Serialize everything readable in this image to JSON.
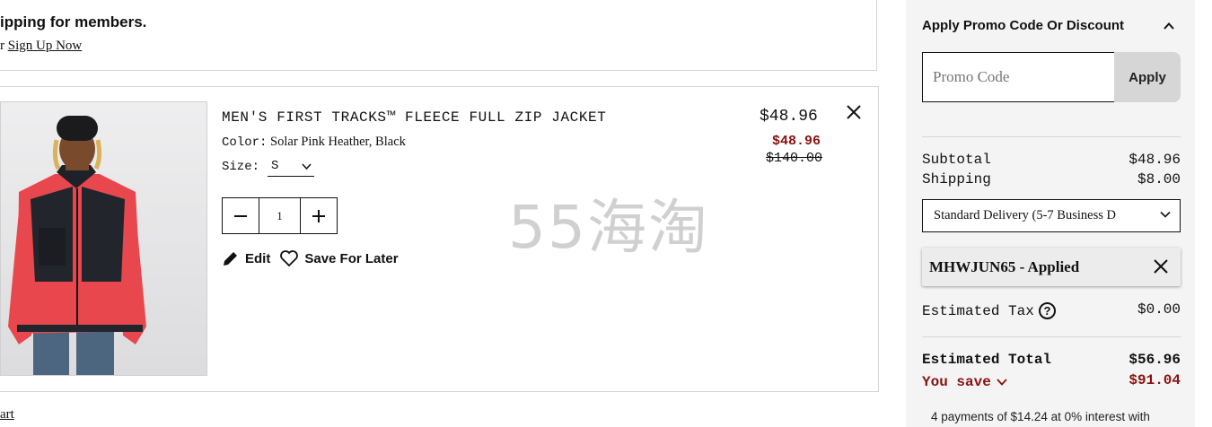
{
  "banner": {
    "title": "ipping for members.",
    "sub_prefix": "r",
    "sign_up_link": "Sign Up Now"
  },
  "product": {
    "name": "MEN'S FIRST TRACKS™ FLEECE FULL ZIP JACKET",
    "color_label": "Color:",
    "color_value": "Solar Pink Heather, Black",
    "size_label": "Size:",
    "size_value": "S",
    "quantity": "1",
    "edit_label": "Edit",
    "save_later_label": "Save For Later",
    "price": "$48.96",
    "sale_price": "$48.96",
    "original_price": "$140.00"
  },
  "watermark": "55海淘",
  "cart_link": "art",
  "summary": {
    "promo_title": "Apply Promo Code Or Discount",
    "promo_placeholder": "Promo Code",
    "apply_label": "Apply",
    "subtotal_label": "Subtotal",
    "subtotal_value": "$48.96",
    "shipping_label": "Shipping",
    "shipping_value": "$8.00",
    "shipping_option": "Standard Delivery (5-7 Business D",
    "coupon_text": "MHWJUN65 - Applied",
    "tax_label": "Estimated Tax",
    "tax_value": "$0.00",
    "total_label": "Estimated Total",
    "total_value": "$56.96",
    "you_save_label": "You save",
    "you_save_value": "$91.04",
    "installments": "4 payments of $14.24 at 0% interest with"
  },
  "colors": {
    "sale_red": "#8a1111",
    "sidebar_bg": "#f4f4f4",
    "apply_bg": "#d6d6d6"
  }
}
